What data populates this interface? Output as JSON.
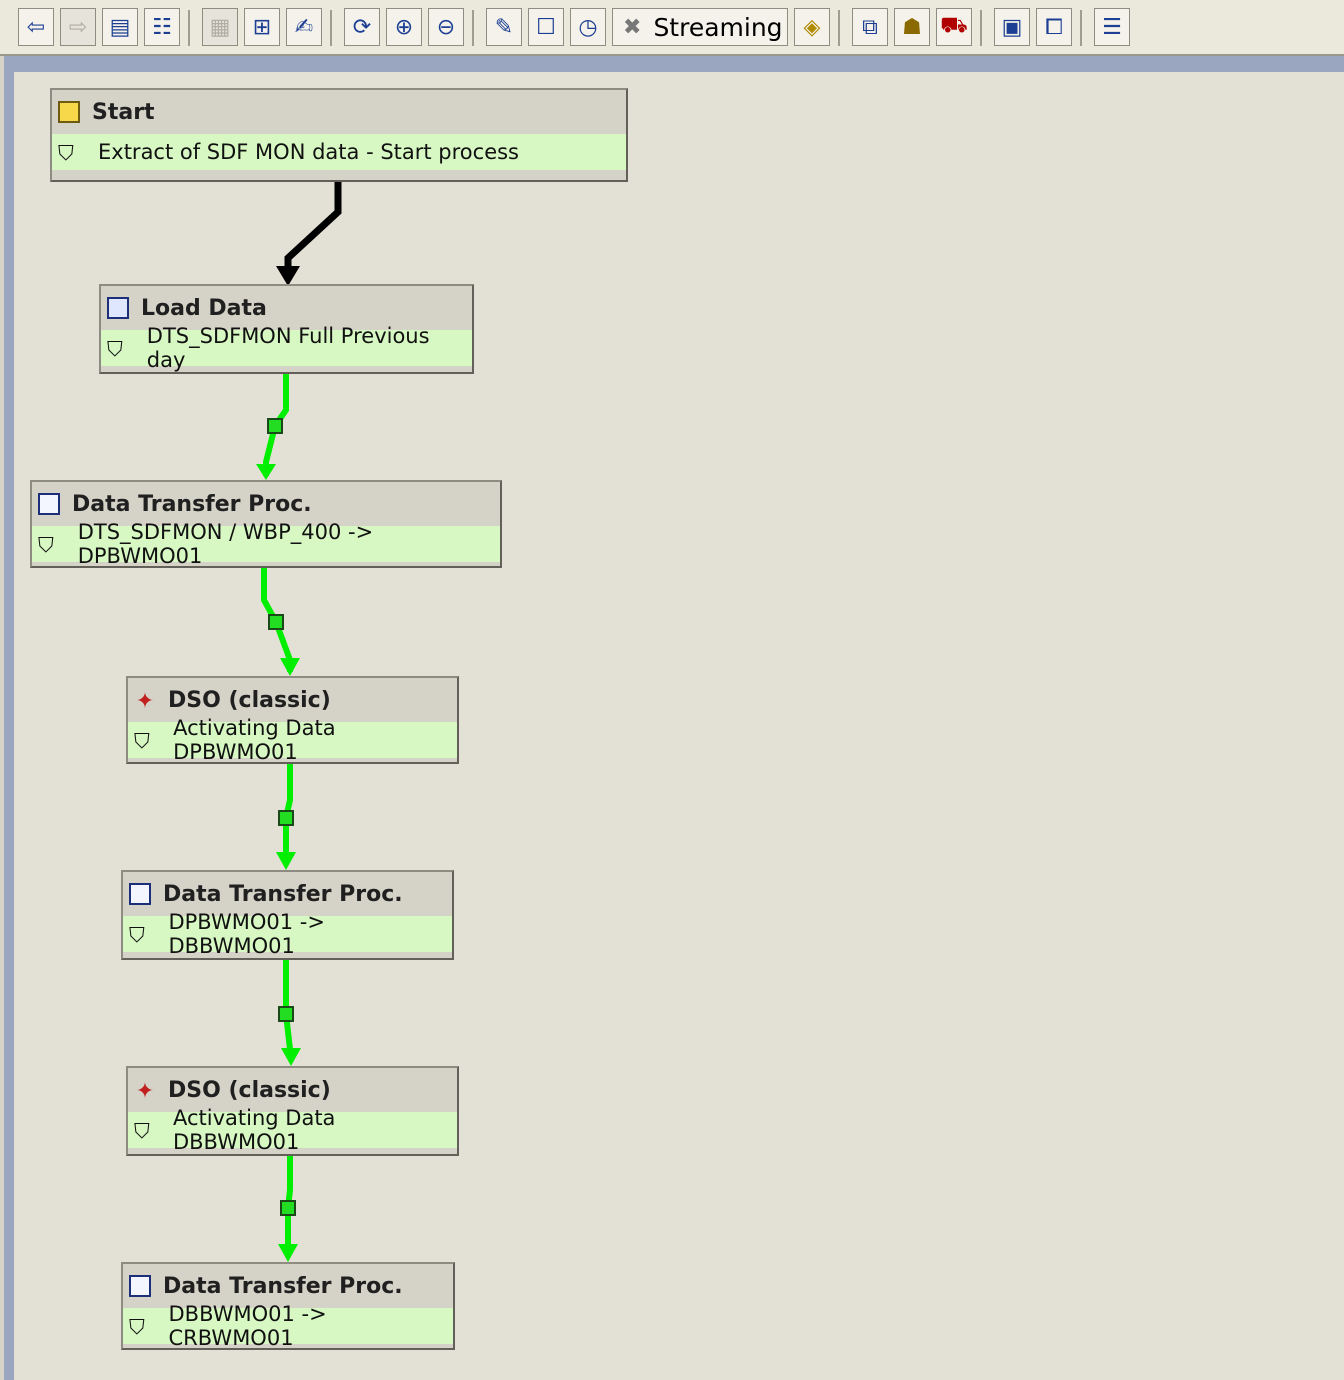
{
  "toolbar": {
    "streaming_label": "Streaming",
    "buttons": [
      "back-icon",
      "forward-icon",
      "list-icon",
      "tree-icon",
      "grid-icon",
      "hierarchy-icon",
      "script-icon",
      "refresh-icon",
      "zoom-in-icon",
      "zoom-out-icon",
      "wand-icon",
      "new-page-icon",
      "schedule-icon",
      "start-variant-icon",
      "layout-icon",
      "user-icon",
      "truck-icon",
      "monitor-icon",
      "windows-icon",
      "report-icon"
    ]
  },
  "nodes": [
    {
      "title": "Start",
      "detail": "Extract of SDF MON data - Start process",
      "icon": "start-icon"
    },
    {
      "title": "Load Data",
      "detail": "DTS_SDFMON Full Previous day",
      "icon": "load-icon"
    },
    {
      "title": "Data Transfer Proc.",
      "detail": "DTS_SDFMON / WBP_400 -> DPBWMO01",
      "icon": "dtp-icon"
    },
    {
      "title": "DSO (classic)",
      "detail": "Activating Data DPBWMO01",
      "icon": "dso-icon"
    },
    {
      "title": "Data Transfer Proc.",
      "detail": "DPBWMO01 -> DBBWMO01",
      "icon": "dtp-icon"
    },
    {
      "title": "DSO (classic)",
      "detail": "Activating Data DBBWMO01",
      "icon": "dso-icon"
    },
    {
      "title": "Data Transfer Proc.",
      "detail": "DBBWMO01 -> CRBWMO01",
      "icon": "dtp-icon"
    }
  ],
  "colors": {
    "success_connector": "#00ee00",
    "start_connector": "#000000",
    "detail_row_bg": "#d7f8c3"
  }
}
